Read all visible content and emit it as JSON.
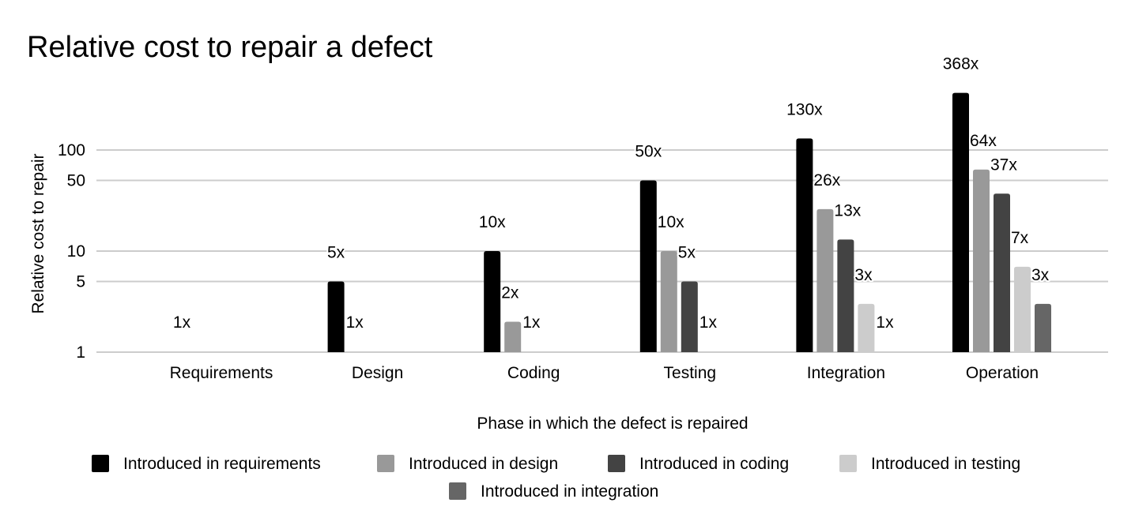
{
  "chart_data": {
    "type": "bar",
    "title": "Relative cost to repair a defect",
    "xlabel": "Phase in which the defect is repaired",
    "ylabel": "Relative cost to repair",
    "yscale": "log",
    "ylim": [
      1,
      368
    ],
    "yticks": [
      1,
      5,
      10,
      50,
      100
    ],
    "ytick_labels": [
      "1",
      "5",
      "10",
      "50",
      "100"
    ],
    "grid": true,
    "legend_position": "bottom",
    "categories": [
      "Requirements",
      "Design",
      "Coding",
      "Testing",
      "Integration",
      "Operation"
    ],
    "series": [
      {
        "name": "Introduced in requirements",
        "color": "#000000",
        "values": [
          1,
          5,
          10,
          50,
          130,
          368
        ],
        "labels": [
          "1x",
          "5x",
          "10x",
          "50x",
          "130x",
          "368x"
        ]
      },
      {
        "name": "Introduced in design",
        "color": "#999999",
        "values": [
          null,
          1,
          2,
          10,
          26,
          64
        ],
        "labels": [
          null,
          "1x",
          "2x",
          "10x",
          "26x",
          "64x"
        ]
      },
      {
        "name": "Introduced in coding",
        "color": "#434343",
        "values": [
          null,
          null,
          1,
          5,
          13,
          37
        ],
        "labels": [
          null,
          null,
          "1x",
          "5x",
          "13x",
          "37x"
        ]
      },
      {
        "name": "Introduced in testing",
        "color": "#cccccc",
        "values": [
          null,
          null,
          null,
          1,
          3,
          7
        ],
        "labels": [
          null,
          null,
          null,
          "1x",
          "3x",
          "7x"
        ]
      },
      {
        "name": "Introduced in integration",
        "color": "#666666",
        "values": [
          null,
          null,
          null,
          null,
          1,
          3
        ],
        "labels": [
          null,
          null,
          null,
          null,
          "1x",
          "3x"
        ]
      }
    ]
  }
}
